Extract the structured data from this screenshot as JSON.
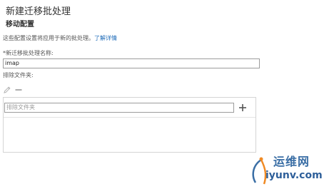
{
  "header": {
    "title": "新建迁移批处理",
    "subtitle": "移动配置"
  },
  "intro": {
    "text": "这些配置设置将应用于新的批处理。",
    "link": "了解详情"
  },
  "batch_name": {
    "label": "*新迁移批处理名称:",
    "value": "imap"
  },
  "exclude_folders": {
    "label": "排除文件夹:",
    "placeholder": "排除文件夹",
    "edit_icon": "pencil-icon",
    "remove_icon": "minus-icon",
    "add_icon": "plus-icon",
    "items": []
  },
  "watermark": {
    "brand": "运维网",
    "url": "iyunv.com"
  },
  "colors": {
    "link": "#1e6bb8",
    "watermark_blue": "#3a6ea5",
    "watermark_orange": "#f08a24"
  }
}
